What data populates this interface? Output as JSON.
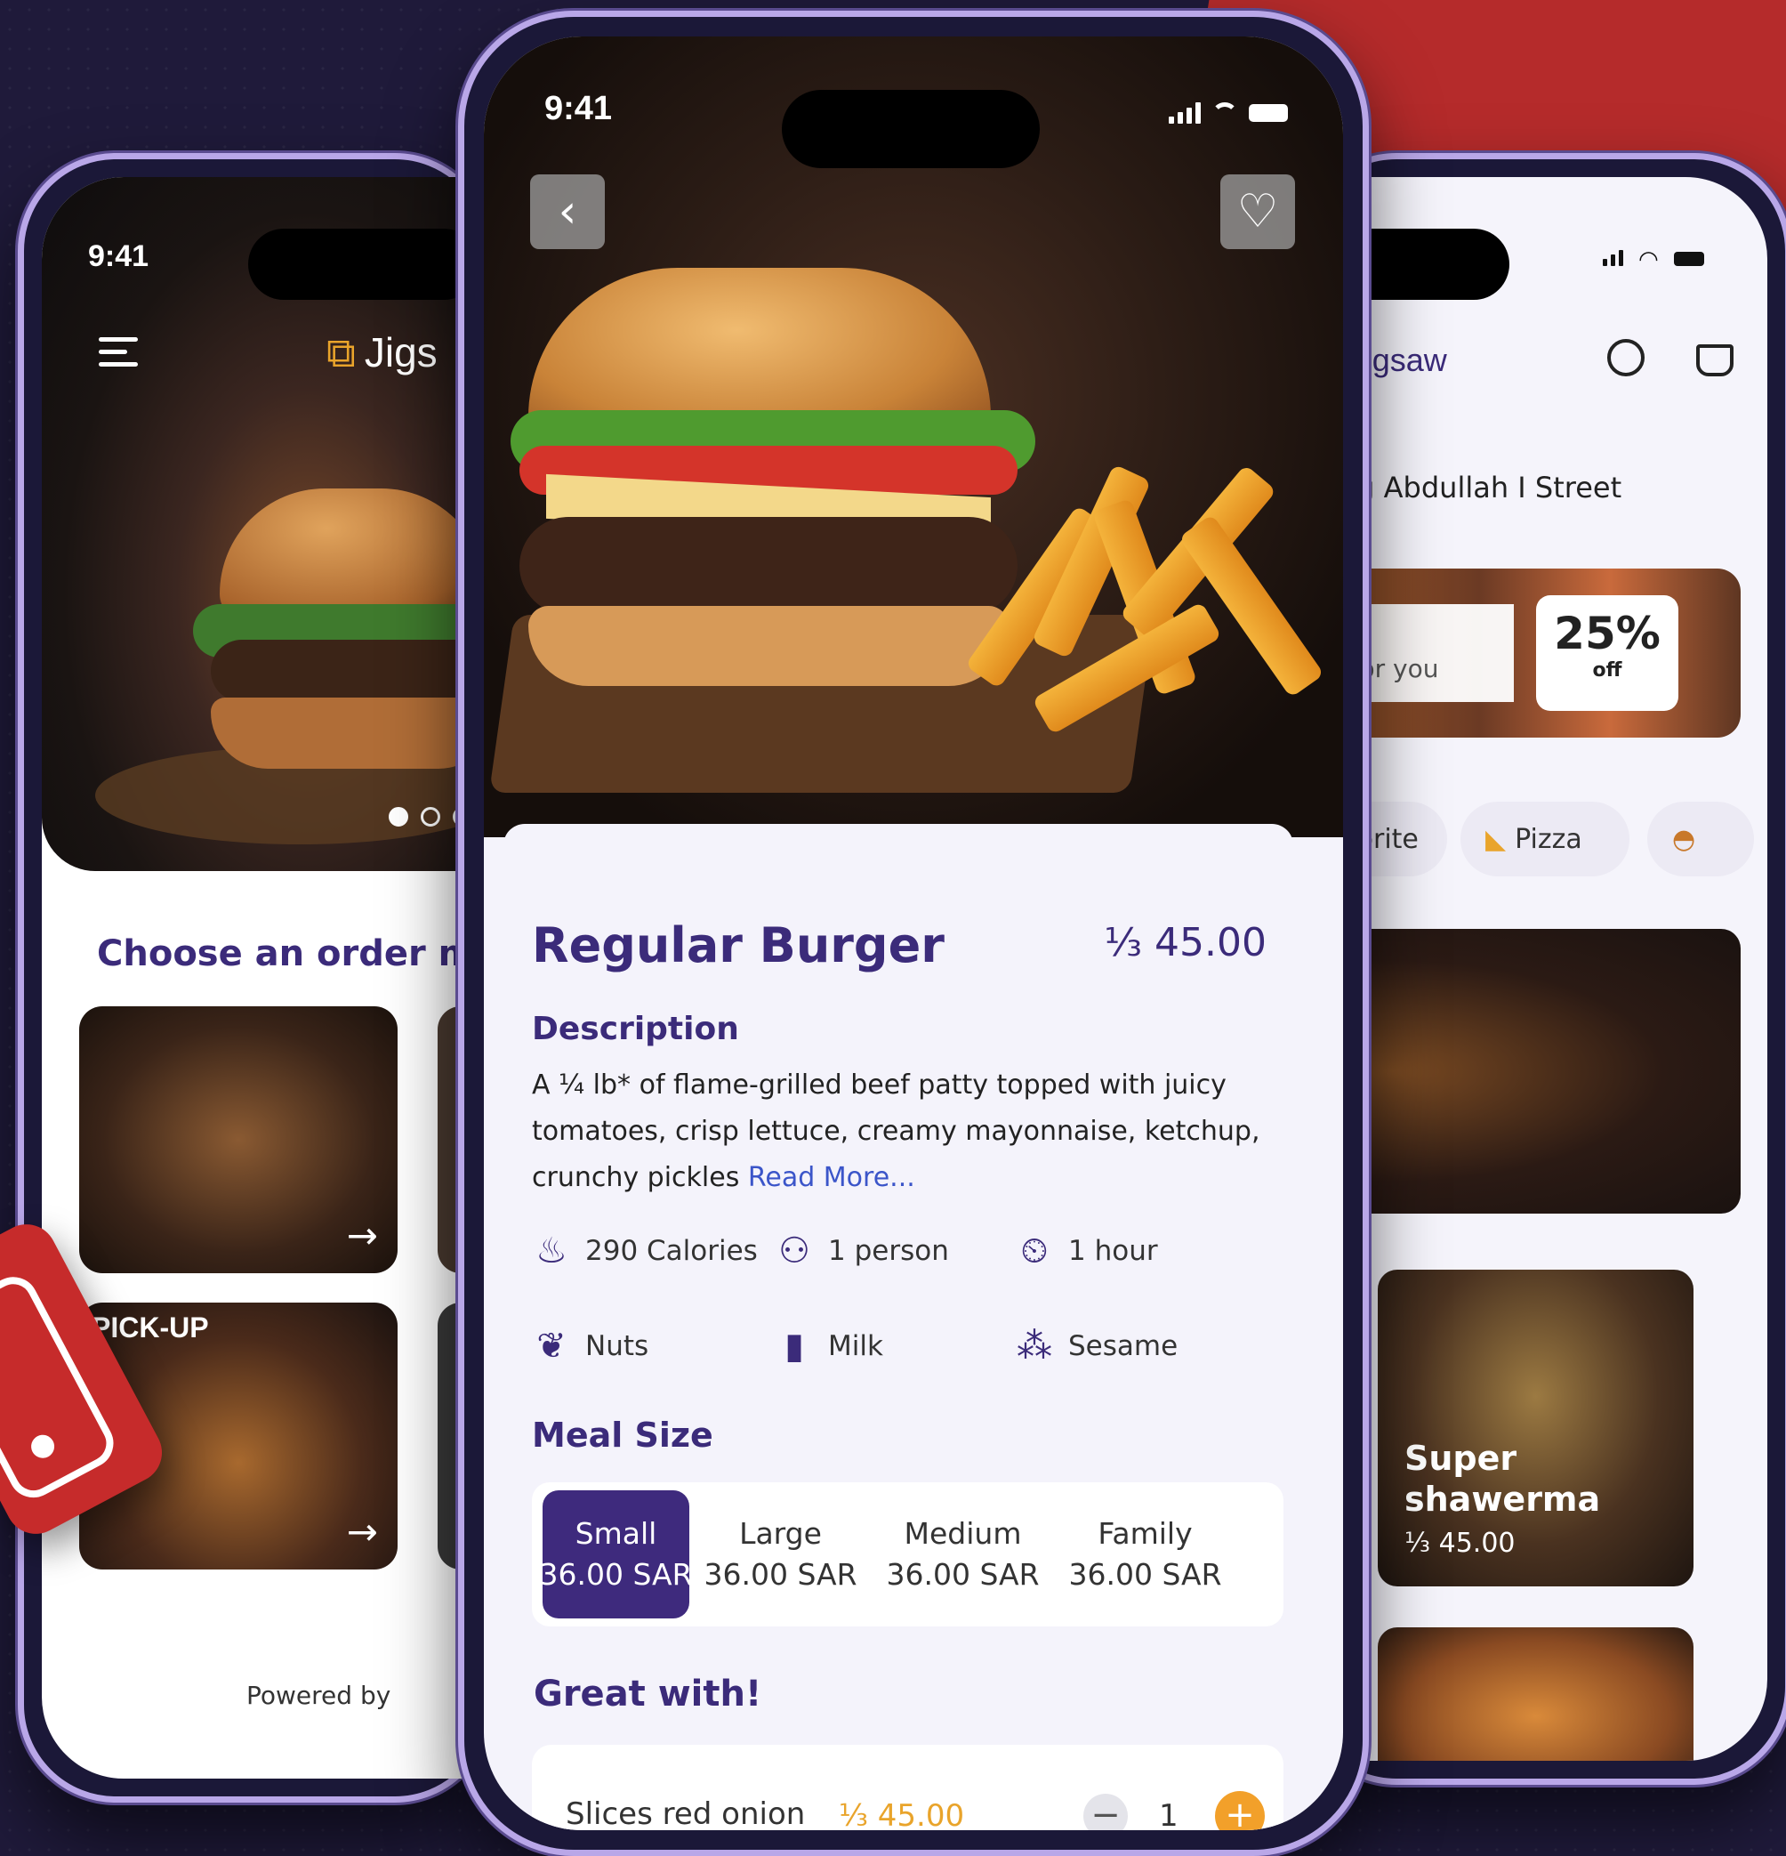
{
  "colors": {
    "brand_purple": "#3b2b7a",
    "accent_orange": "#e9a42b",
    "red": "#b52b2b",
    "background": "#1f1a3a"
  },
  "left_phone": {
    "time": "9:41",
    "logo_text": "Jigs",
    "menu_icon": "hamburger-icon",
    "section_title": "Choose an order met",
    "tile_label": "PICK-UP",
    "arrow_icon": "arrow-right-icon",
    "powered_by": "Powered by"
  },
  "center_phone": {
    "time": "9:41",
    "back_icon": "chevron-left-icon",
    "favorite_icon": "heart-icon",
    "product": {
      "name": "Regular Burger",
      "price": "⅓ 45.00",
      "description_heading": "Description",
      "description": "A ¼ lb* of flame-grilled beef patty topped with juicy tomatoes, crisp lettuce, creamy mayonnaise, ketchup, crunchy pickles",
      "read_more": "Read More..."
    },
    "facts": [
      {
        "icon": "flame-icon",
        "label": "290 Calories"
      },
      {
        "icon": "person-icon",
        "label": "1 person"
      },
      {
        "icon": "cloche-icon",
        "label": "1 hour"
      },
      {
        "icon": "nuts-icon",
        "label": "Nuts"
      },
      {
        "icon": "milk-icon",
        "label": "Milk"
      },
      {
        "icon": "sesame-icon",
        "label": "Sesame"
      }
    ],
    "meal_size_heading": "Meal Size",
    "sizes": [
      {
        "name": "Small",
        "price": "36.00 SAR",
        "selected": true
      },
      {
        "name": "Large",
        "price": "36.00 SAR",
        "selected": false
      },
      {
        "name": "Medium",
        "price": "36.00 SAR",
        "selected": false
      },
      {
        "name": "Family",
        "price": "36.00 SAR",
        "selected": false
      }
    ],
    "great_with_heading": "Great with!",
    "extra": {
      "name": "Slices red onion",
      "price": "⅓ 45.00",
      "quantity": "1",
      "minus": "−",
      "plus": "+"
    }
  },
  "right_phone": {
    "logo_text": "Jigsaw",
    "search_icon": "search-icon",
    "basket_icon": "basket-icon",
    "street": "King Abdullah I Street",
    "banner_text": "ial for you",
    "discount_pct": "25%",
    "discount_off": "off",
    "chips": [
      {
        "label": "Favorite"
      },
      {
        "label": "Pizza",
        "icon": "pizza-icon"
      },
      {
        "label": "",
        "icon": "burger-icon"
      }
    ],
    "card": {
      "name_line1": "Super",
      "name_line2": "shawerma",
      "price": "⅓ 45.00"
    }
  }
}
